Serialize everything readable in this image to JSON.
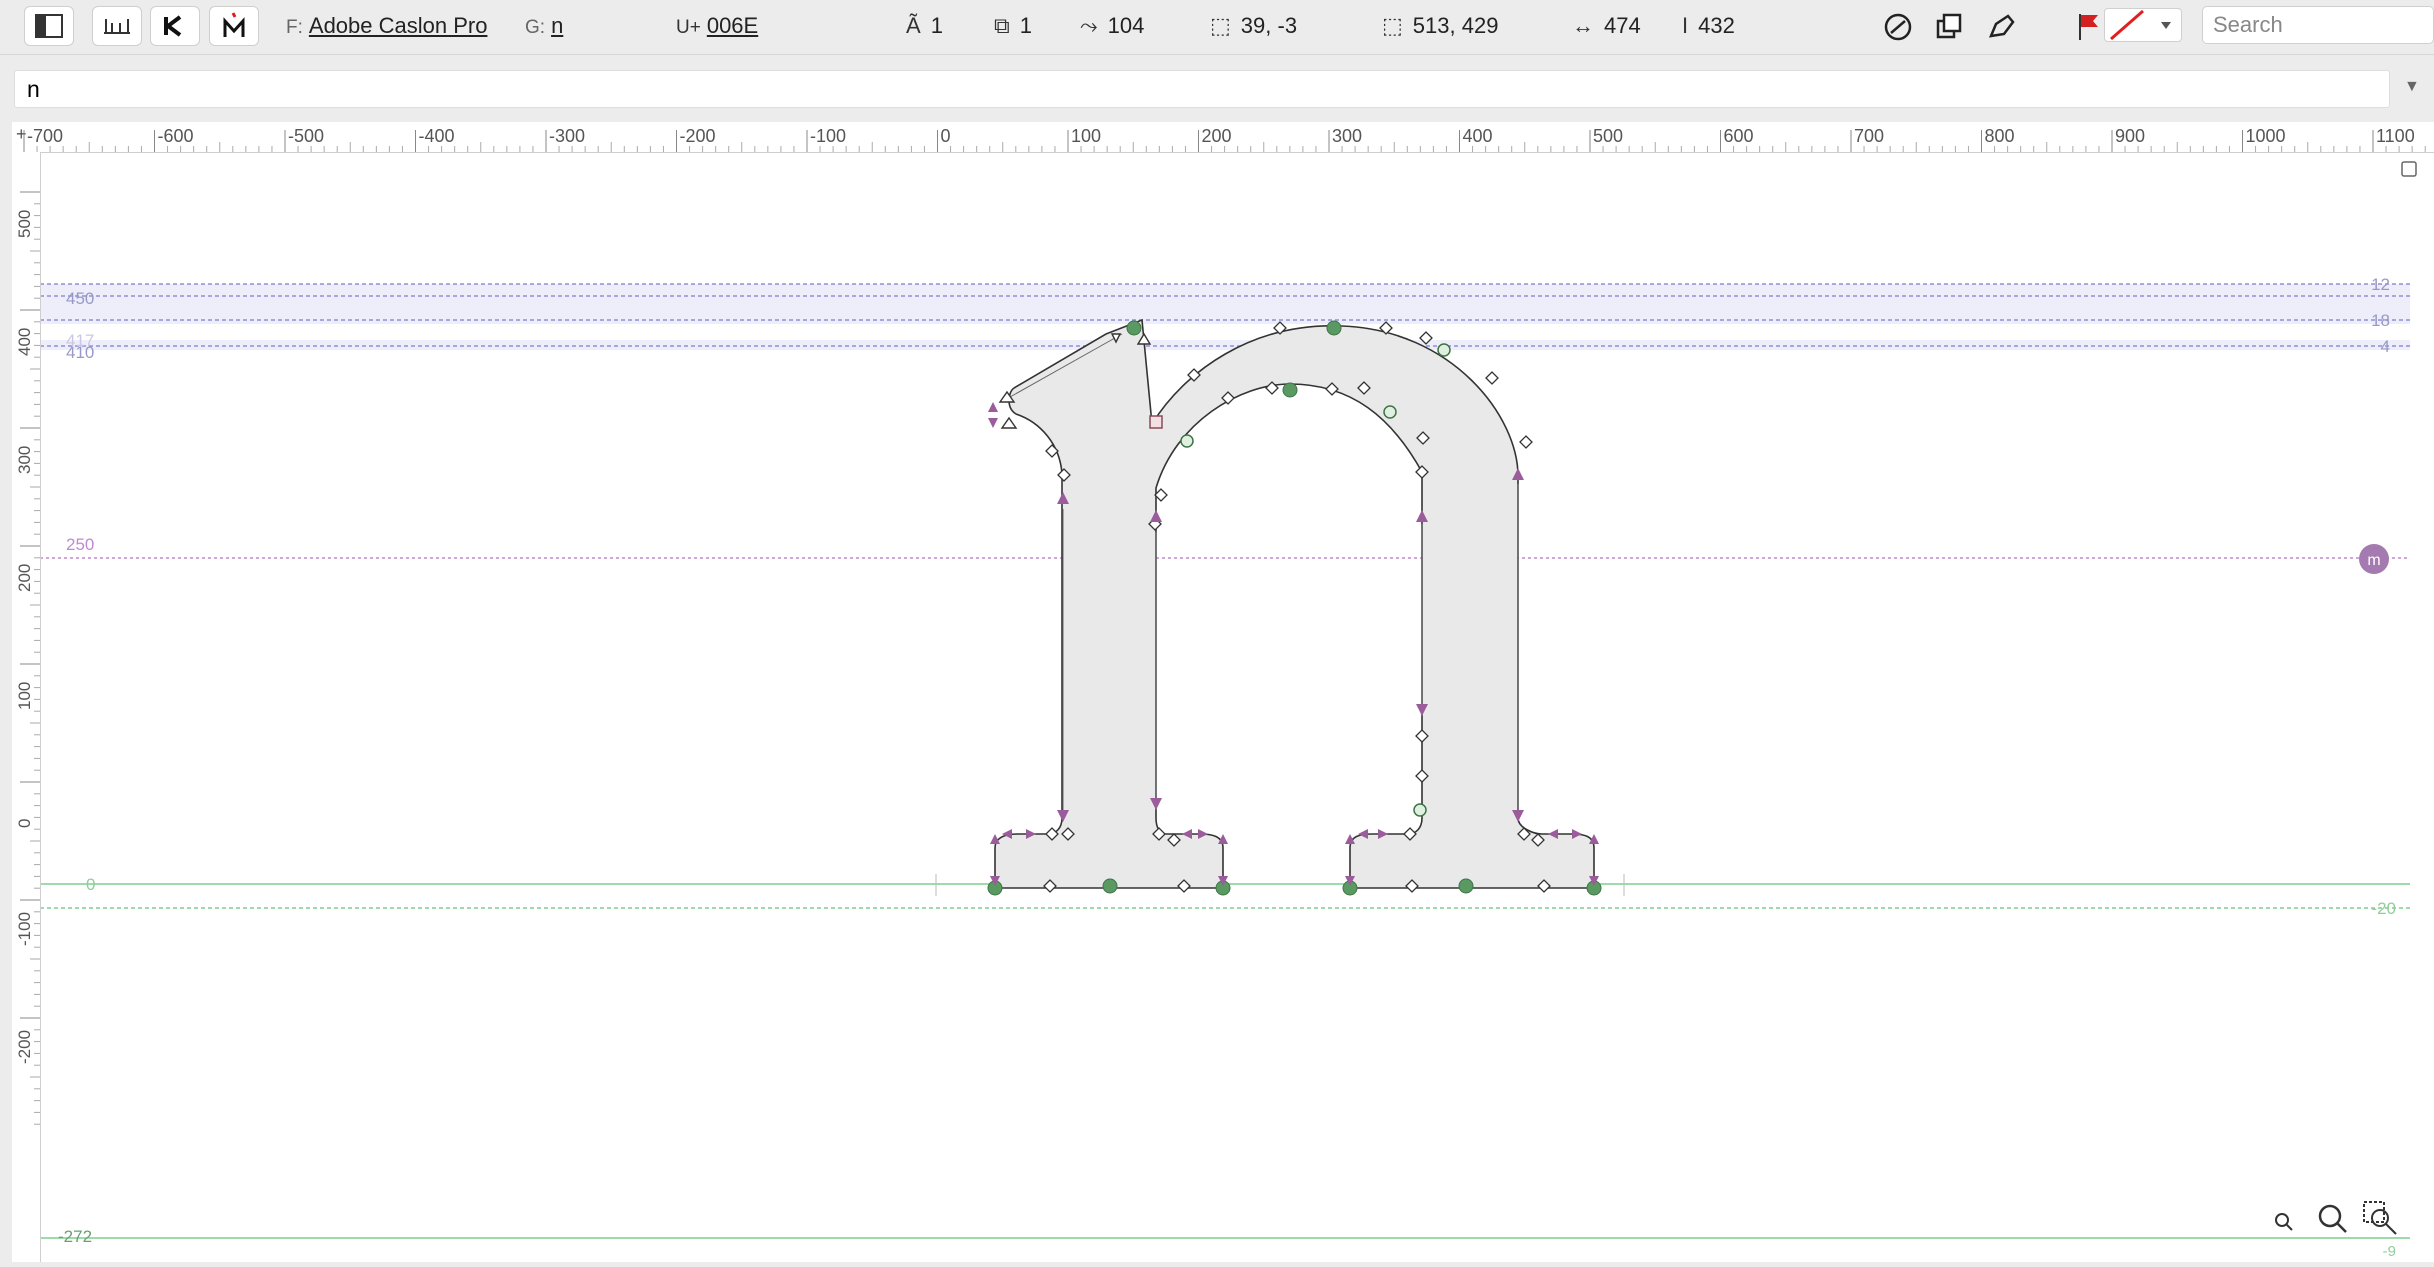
{
  "toolbar": {
    "font_label": "F:",
    "font_name": "Adobe Caslon Pro",
    "glyph_label": "G:",
    "glyph_name": "n",
    "unicode_label": "U+",
    "unicode_value": "006E",
    "layers_count": "1",
    "components_count": "1",
    "nodes_count": "104",
    "position_value": "39, -3",
    "size_value": "513, 429",
    "width_value": "474",
    "height_value": "432",
    "search_placeholder": "Search"
  },
  "glyph_field": {
    "value": "n"
  },
  "rulers": {
    "horizontal_ticks": [
      "-700",
      "-600",
      "-500",
      "-400",
      "-300",
      "-200",
      "-100",
      "0",
      "100",
      "200",
      "300",
      "400",
      "500",
      "600",
      "700",
      "800",
      "900",
      "1000",
      "1100"
    ],
    "vertical_ticks": [
      "500",
      "400",
      "300",
      "200",
      "100",
      "0",
      "-100",
      "-200"
    ]
  },
  "guides": {
    "left_labels": [
      "450",
      "417",
      "410",
      "250",
      "0",
      "-272"
    ],
    "right_labels": [
      "12",
      "18",
      "4",
      "-20",
      "-9"
    ],
    "anchor_label": "m"
  },
  "colors": {
    "accent_purple": "#9b5c9b",
    "node_green": "#5a9a62",
    "guide_blue": "#8f8fd6",
    "guide_green": "#7fcf8f",
    "flag_red": "#d42020"
  }
}
